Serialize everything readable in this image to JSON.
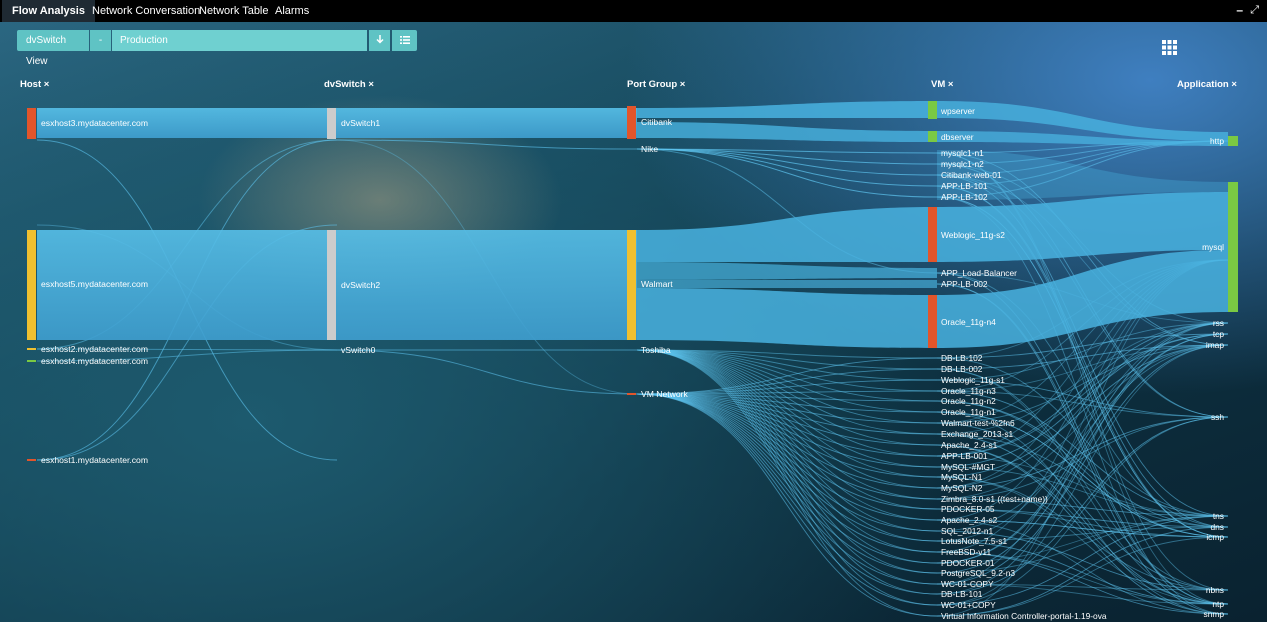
{
  "tabs": [
    "Flow Analysis",
    "Network Conversation",
    "Network Table",
    "Alarms"
  ],
  "window": {
    "minimize": "–",
    "expand": "⤢"
  },
  "toolbar": {
    "view_label": "dvSwitch View",
    "dash": "-",
    "filter_value": "Production",
    "download_icon": "download-icon",
    "list_icon": "list-icon"
  },
  "grid_icon": "grid-icon",
  "columns": {
    "host": "Host",
    "dvswitch": "dvSwitch",
    "portgroup": "Port Group",
    "vm": "VM",
    "application": "Application"
  },
  "remove_glyph": "×",
  "colors": {
    "bar_fill": "#49b3e0",
    "link": "#5ec5f0",
    "node_orange": "#e2552b",
    "node_yellow": "#f0c030",
    "node_gray": "#cccccc",
    "node_green": "#7ac943",
    "top_bar": "#000000"
  },
  "hosts": [
    "esxhost3.mydatacenter.com",
    "esxhost5.mydatacenter.com",
    "esxhost2.mydatacenter.com",
    "esxhost4.mydatacenter.com",
    "esxhost1.mydatacenter.com"
  ],
  "dvswitches": [
    "dvSwitch1",
    "dvSwitch2",
    "vSwitch0"
  ],
  "portgroups": [
    "Citibank",
    "Nike",
    "Walmart",
    "Toshiba",
    "VM Network"
  ],
  "vms": [
    "wpserver",
    "dbserver",
    "mysqlc1-n1",
    "mysqlc1-n2",
    "Citibank-web-01",
    "APP-LB-101",
    "APP-LB-102",
    "Weblogic_11g-s2",
    "APP_Load-Balancer",
    "APP-LB-002",
    "Oracle_11g-n4",
    "DB-LB-102",
    "DB-LB-002",
    "Weblogic_11g-s1",
    "Oracle_11g-n3",
    "Oracle_11g-n2",
    "Oracle_11g-n1",
    "Walmart-test-%2fn6",
    "Exchange_2013-s1",
    "Apache_2.4-s1",
    "APP-LB-001",
    "MySQL-#MGT",
    "MySQL-N1",
    "MySQL-N2",
    "Zimbra_8.0-s1 ((test+name))",
    "PDOCKER-05",
    "Apache_2.4-s2",
    "SQL_2012-n1",
    "LotusNote_7.5-s1",
    "FreeBSD-v11",
    "PDOCKER-01",
    "PostgreSQL_9.2-n3",
    "WC-01-COPY",
    "DB-LB-101",
    "WC-01+COPY",
    "Virtual Information Controller-portal-1.19-ova"
  ],
  "applications": [
    "http",
    "mysql",
    "rss",
    "tcp",
    "imap",
    "ssh",
    "tns",
    "dns",
    "icmp",
    "nbns",
    "ntp",
    "snmp"
  ]
}
